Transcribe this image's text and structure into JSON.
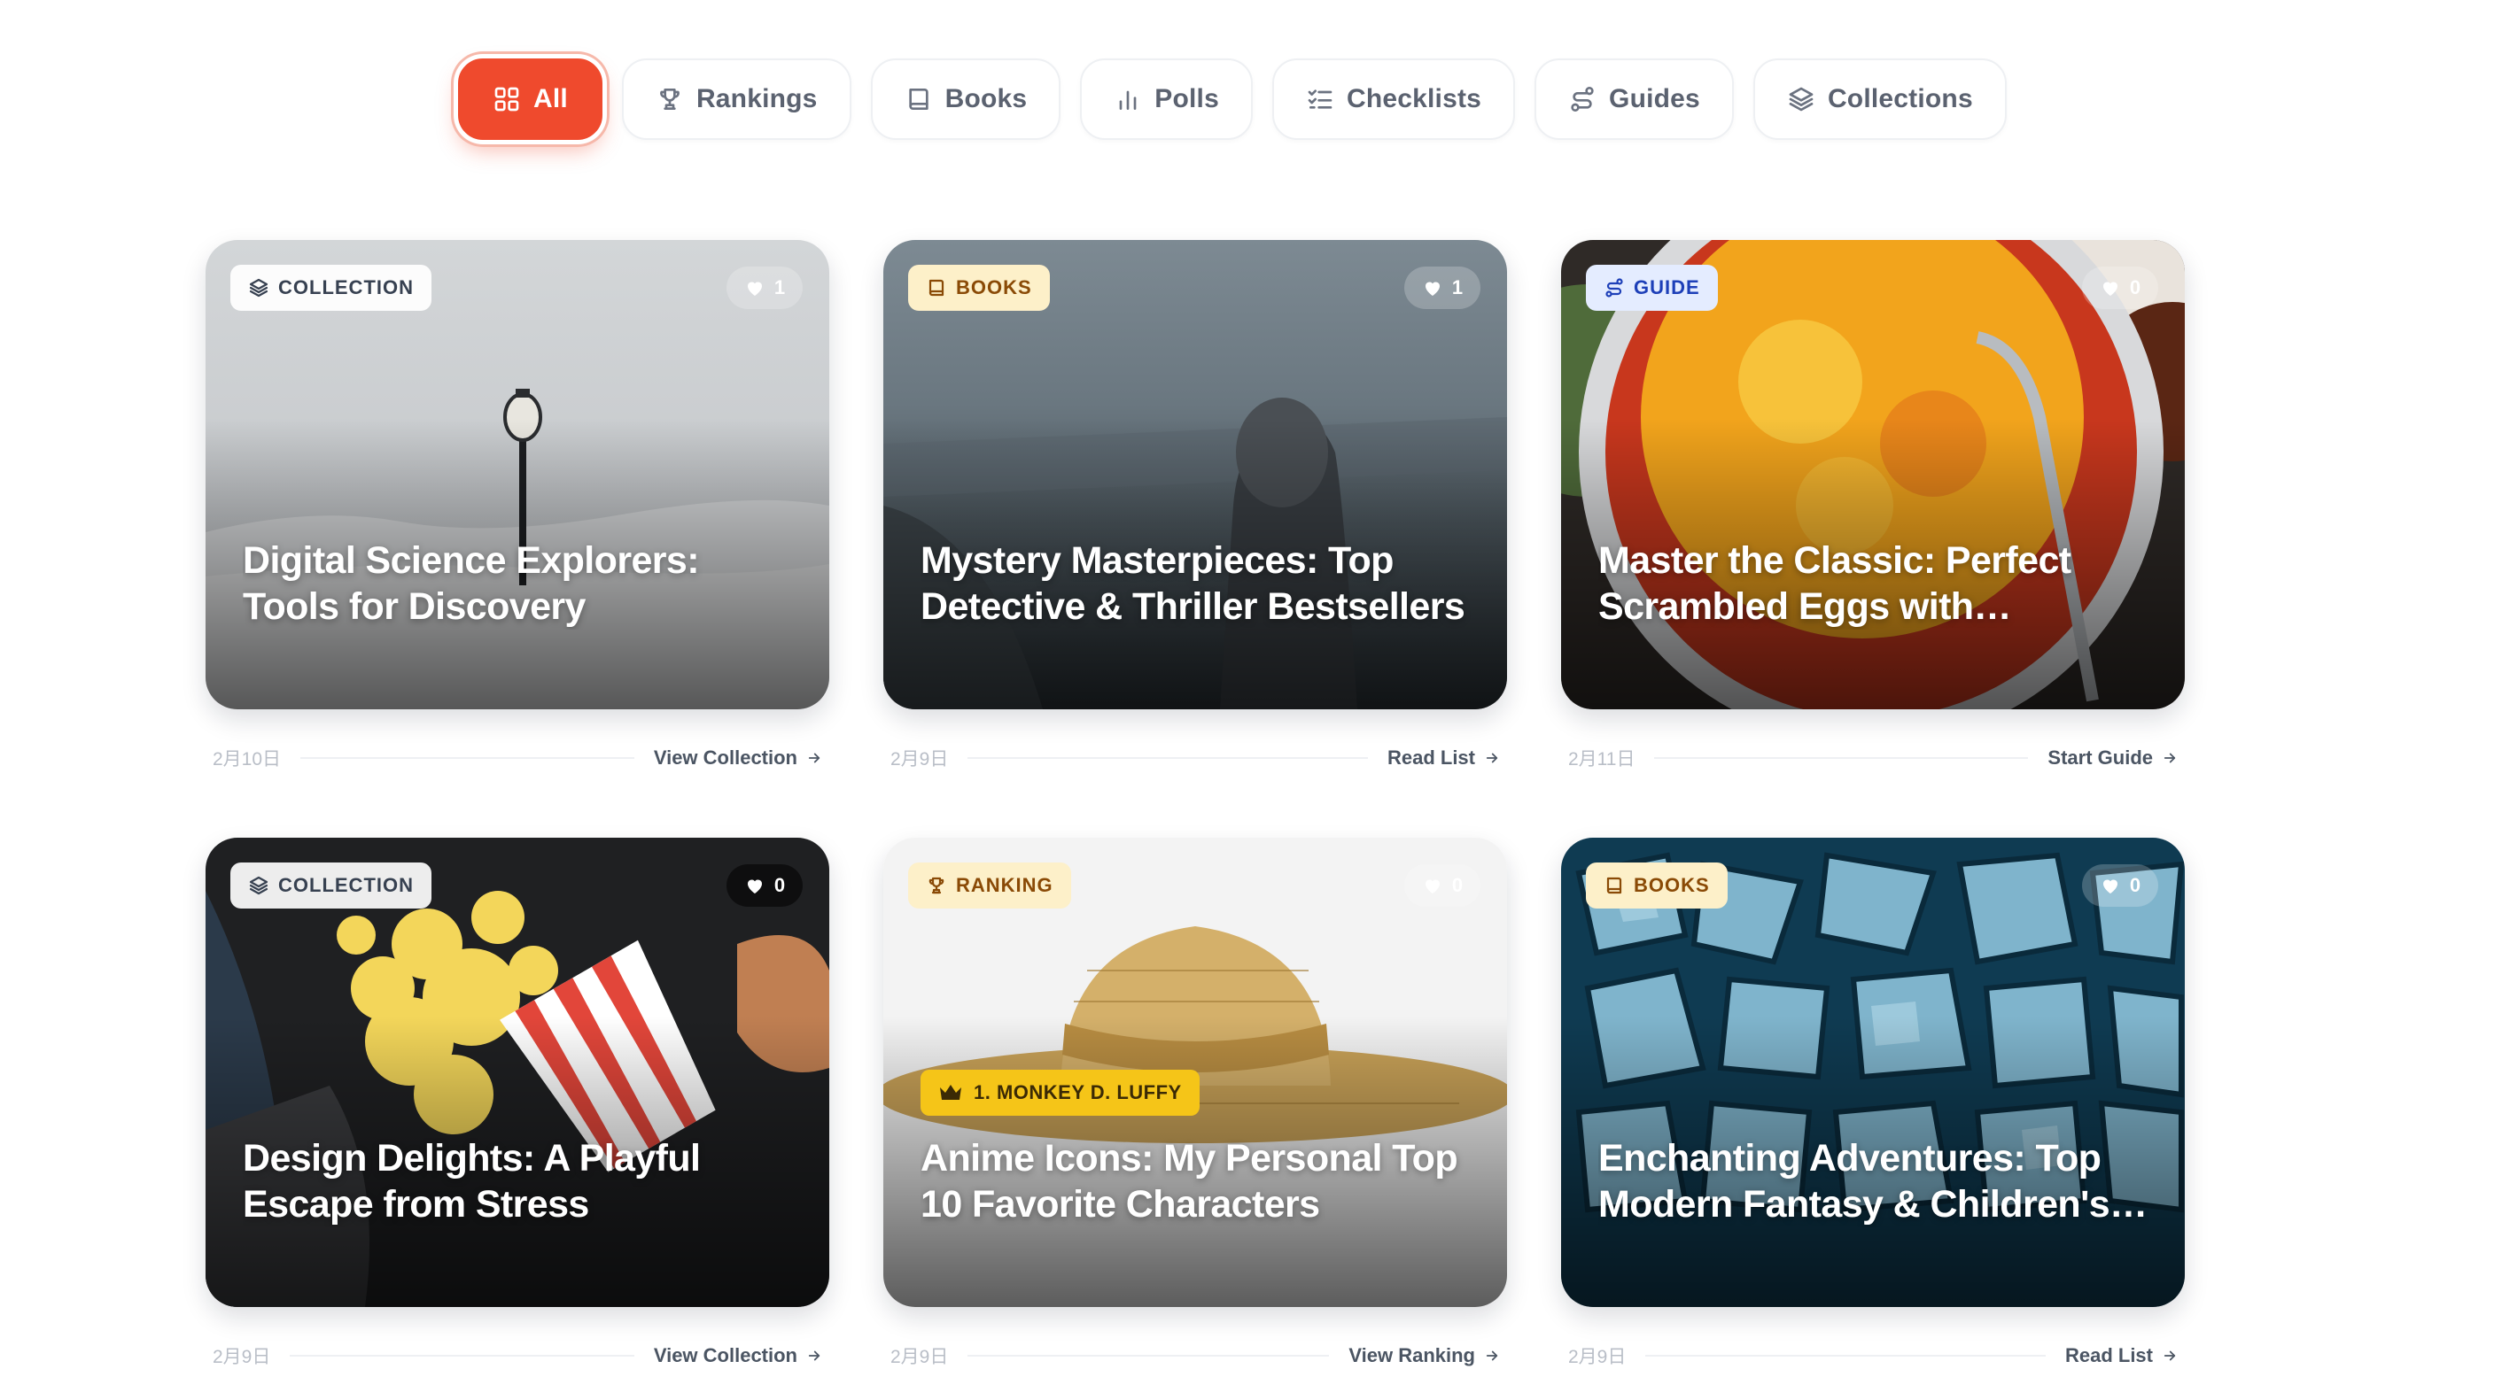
{
  "filters": [
    {
      "label": "All",
      "icon": "grid-icon",
      "active": true
    },
    {
      "label": "Rankings",
      "icon": "trophy-icon",
      "active": false
    },
    {
      "label": "Books",
      "icon": "book-icon",
      "active": false
    },
    {
      "label": "Polls",
      "icon": "bar-chart-icon",
      "active": false
    },
    {
      "label": "Checklists",
      "icon": "checklist-icon",
      "active": false
    },
    {
      "label": "Guides",
      "icon": "route-icon",
      "active": false
    },
    {
      "label": "Collections",
      "icon": "layers-icon",
      "active": false
    }
  ],
  "accent_color": "#ef4a2d",
  "cards": [
    {
      "badge": "COLLECTION",
      "badge_icon": "layers-icon",
      "likes": "1",
      "title": "Digital Science Explorers: Tools for Discovery",
      "date": "2月10日",
      "action": "View Collection"
    },
    {
      "badge": "BOOKS",
      "badge_icon": "book-icon",
      "likes": "1",
      "title": "Mystery Masterpieces: Top Detective & Thriller Bestsellers",
      "date": "2月9日",
      "action": "Read List"
    },
    {
      "badge": "GUIDE",
      "badge_icon": "route-icon",
      "likes": "0",
      "title": "Master the Classic: Perfect Scrambled Eggs with…",
      "date": "2月11日",
      "action": "Start Guide"
    },
    {
      "badge": "COLLECTION",
      "badge_icon": "layers-icon",
      "likes": "0",
      "title": "Design Delights: A Playful Escape from Stress",
      "date": "2月9日",
      "action": "View Collection"
    },
    {
      "badge": "RANKING",
      "badge_icon": "trophy-icon",
      "likes": "0",
      "rank_label": "1. MONKEY D. LUFFY",
      "title": "Anime Icons: My Personal Top 10 Favorite Characters",
      "date": "2月9日",
      "action": "View Ranking"
    },
    {
      "badge": "BOOKS",
      "badge_icon": "book-icon",
      "likes": "0",
      "title": "Enchanting Adventures: Top Modern Fantasy & Children's…",
      "date": "2月9日",
      "action": "Read List"
    }
  ]
}
